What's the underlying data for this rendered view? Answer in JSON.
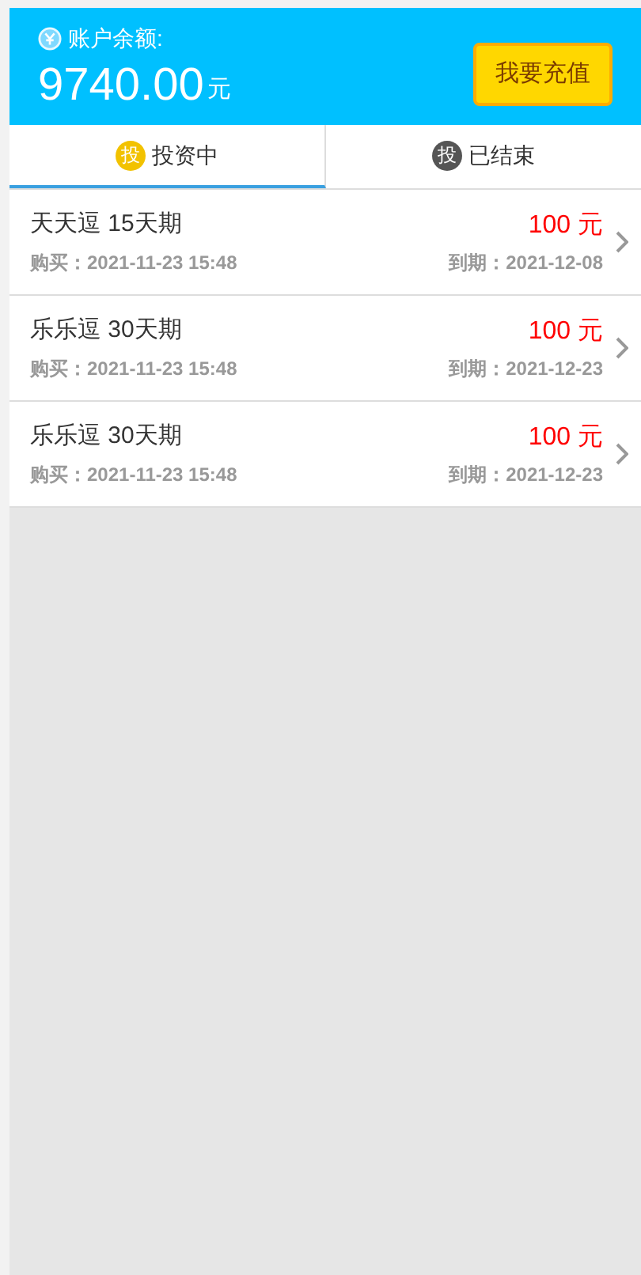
{
  "balance": {
    "label": "账户余额:",
    "amount": "9740.00",
    "unit": "元"
  },
  "recharge_button": "我要充值",
  "tabs": [
    {
      "badge": "投",
      "label": "投资中",
      "selected": true
    },
    {
      "badge": "投",
      "label": "已结束",
      "selected": false
    }
  ],
  "investments": [
    {
      "name": "天天逗 15天期",
      "amount": "100 元",
      "bought": "购买：2021-11-23 15:48",
      "due": "到期：2021-12-08"
    },
    {
      "name": "乐乐逗 30天期",
      "amount": "100 元",
      "bought": "购买：2021-11-23 15:48",
      "due": "到期：2021-12-23"
    },
    {
      "name": "乐乐逗 30天期",
      "amount": "100 元",
      "bought": "购买：2021-11-23 15:48",
      "due": "到期：2021-12-23"
    }
  ]
}
